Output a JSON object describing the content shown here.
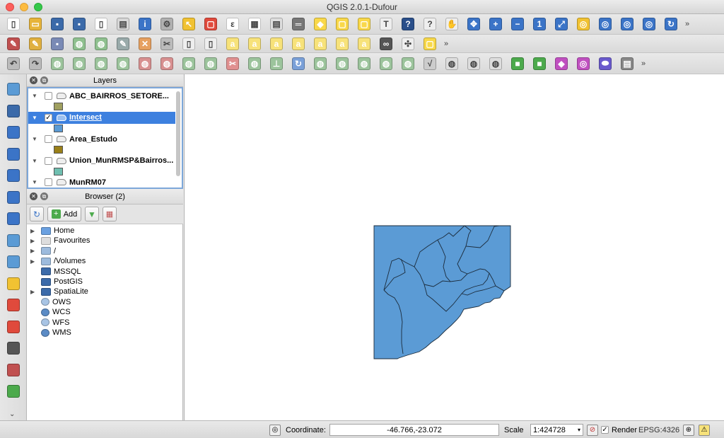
{
  "window": {
    "title": "QGIS 2.0.1-Dufour"
  },
  "toolbar_rows": [
    {
      "icons": [
        {
          "name": "new-project-icon",
          "color": "#ffffff",
          "glyph": "▯"
        },
        {
          "name": "open-project-icon",
          "color": "#e7b43a",
          "glyph": "▭"
        },
        {
          "name": "save-project-icon",
          "color": "#3b6aa9",
          "glyph": "▪"
        },
        {
          "name": "save-as-icon",
          "color": "#3b6aa9",
          "glyph": "▪"
        },
        {
          "name": "new-print-composer-icon",
          "color": "#ffffff",
          "glyph": "▯"
        },
        {
          "name": "composer-manager-icon",
          "color": "#d7d7d7",
          "glyph": "▤"
        },
        {
          "name": "identify-features-icon",
          "color": "#3b74c7",
          "glyph": "i"
        },
        {
          "name": "settings-gear-icon",
          "color": "#b0b0b0",
          "glyph": "⚙"
        },
        {
          "name": "select-features-icon",
          "color": "#f1c232",
          "glyph": "↖"
        },
        {
          "name": "deselect-icon",
          "color": "#e04a3c",
          "glyph": "▢"
        },
        {
          "name": "field-calculator-icon",
          "color": "#ffffff",
          "glyph": "ε"
        },
        {
          "name": "attribute-table-icon",
          "color": "#ffffff",
          "glyph": "▦"
        },
        {
          "name": "statistics-icon",
          "color": "#dddddd",
          "glyph": "▤"
        },
        {
          "name": "measure-line-icon",
          "color": "#777777",
          "glyph": "═"
        },
        {
          "name": "map-tips-icon",
          "color": "#f9d84a",
          "glyph": "◆"
        },
        {
          "name": "new-bookmark-icon",
          "color": "#f9d84a",
          "glyph": "▢"
        },
        {
          "name": "show-bookmarks-icon",
          "color": "#f9d84a",
          "glyph": "▢"
        },
        {
          "name": "text-annotation-icon",
          "color": "#eeeeee",
          "glyph": "T"
        },
        {
          "name": "help-icon",
          "color": "#2a4f8a",
          "glyph": "?"
        },
        {
          "name": "whats-this-icon",
          "color": "#eeeeee",
          "glyph": "?"
        },
        {
          "name": "pan-map-icon",
          "color": "#eeeeee",
          "glyph": "✋"
        },
        {
          "name": "pan-to-selection-icon",
          "color": "#3b74c7",
          "glyph": "✥"
        },
        {
          "name": "zoom-in-icon",
          "color": "#3b74c7",
          "glyph": "+"
        },
        {
          "name": "zoom-out-icon",
          "color": "#3b74c7",
          "glyph": "−"
        },
        {
          "name": "zoom-actual-size-icon",
          "color": "#3b74c7",
          "glyph": "1"
        },
        {
          "name": "zoom-full-icon",
          "color": "#3b74c7",
          "glyph": "⤢"
        },
        {
          "name": "zoom-to-selection-icon",
          "color": "#f1c232",
          "glyph": "◎"
        },
        {
          "name": "zoom-to-layer-icon",
          "color": "#3b74c7",
          "glyph": "◎"
        },
        {
          "name": "zoom-last-icon",
          "color": "#3b74c7",
          "glyph": "◎"
        },
        {
          "name": "zoom-next-icon",
          "color": "#3b74c7",
          "glyph": "◎"
        },
        {
          "name": "refresh-icon",
          "color": "#3b74c7",
          "glyph": "↻"
        }
      ]
    },
    {
      "icons": [
        {
          "name": "current-edits-icon",
          "color": "#c05050",
          "glyph": "✎"
        },
        {
          "name": "toggle-editing-icon",
          "color": "#e0b040",
          "glyph": "✎"
        },
        {
          "name": "save-edits-icon",
          "color": "#7a8ab5",
          "glyph": "▪"
        },
        {
          "name": "add-feature-icon",
          "color": "#8fc08f",
          "glyph": "◍"
        },
        {
          "name": "move-feature-icon",
          "color": "#8fc08f",
          "glyph": "◍"
        },
        {
          "name": "node-tool-icon",
          "color": "#9aa",
          "glyph": "✎"
        },
        {
          "name": "delete-selected-icon",
          "color": "#e6a060",
          "glyph": "✕"
        },
        {
          "name": "cut-features-icon",
          "color": "#bbbbbb",
          "glyph": "✂"
        },
        {
          "name": "copy-features-icon",
          "color": "#eeeeee",
          "glyph": "▯"
        },
        {
          "name": "paste-features-icon",
          "color": "#eeeeee",
          "glyph": "▯"
        },
        {
          "name": "label-icon",
          "color": "#f7e27a",
          "glyph": "a"
        },
        {
          "name": "label-highlight-icon",
          "color": "#f7e27a",
          "glyph": "a"
        },
        {
          "name": "pin-labels-icon",
          "color": "#f7e27a",
          "glyph": "a"
        },
        {
          "name": "show-hide-labels-icon",
          "color": "#f7e27a",
          "glyph": "a"
        },
        {
          "name": "move-label-icon",
          "color": "#f7e27a",
          "glyph": "a"
        },
        {
          "name": "rotate-label-icon",
          "color": "#f7e27a",
          "glyph": "a"
        },
        {
          "name": "change-label-icon",
          "color": "#f7e27a",
          "glyph": "a"
        },
        {
          "name": "find-binoculars-icon",
          "color": "#555555",
          "glyph": "∞"
        },
        {
          "name": "geocode-icon",
          "color": "#eeeeee",
          "glyph": "✣"
        },
        {
          "name": "sticky-note-icon",
          "color": "#f7d84a",
          "glyph": "▢"
        }
      ]
    },
    {
      "icons": [
        {
          "name": "undo-icon",
          "color": "#bbbbbb",
          "glyph": "↶"
        },
        {
          "name": "redo-icon",
          "color": "#bbbbbb",
          "glyph": "↷"
        },
        {
          "name": "simplify-feature-icon",
          "color": "#9cc49c",
          "glyph": "◍"
        },
        {
          "name": "add-ring-icon",
          "color": "#9cc49c",
          "glyph": "◍"
        },
        {
          "name": "add-part-icon",
          "color": "#9cc49c",
          "glyph": "◍"
        },
        {
          "name": "fill-ring-icon",
          "color": "#9cc49c",
          "glyph": "◍"
        },
        {
          "name": "delete-ring-icon",
          "color": "#d89090",
          "glyph": "◍"
        },
        {
          "name": "delete-part-icon",
          "color": "#d89090",
          "glyph": "◍"
        },
        {
          "name": "reshape-features-icon",
          "color": "#9cc49c",
          "glyph": "◍"
        },
        {
          "name": "offset-curve-icon",
          "color": "#9cc49c",
          "glyph": "◍"
        },
        {
          "name": "split-features-icon",
          "color": "#e09090",
          "glyph": "✂"
        },
        {
          "name": "split-parts-icon",
          "color": "#9cc49c",
          "glyph": "◍"
        },
        {
          "name": "merge-selected-icon",
          "color": "#9cc49c",
          "glyph": "⊥"
        },
        {
          "name": "rotate-point-icon",
          "color": "#7aa0d8",
          "glyph": "↻"
        },
        {
          "name": "digitize-icon",
          "color": "#9cc49c",
          "glyph": "◍"
        },
        {
          "name": "advanced-digitize-icon",
          "color": "#9cc49c",
          "glyph": "◍"
        },
        {
          "name": "snapping-icon",
          "color": "#9cc49c",
          "glyph": "◍"
        },
        {
          "name": "trace-icon",
          "color": "#9cc49c",
          "glyph": "◍"
        },
        {
          "name": "vertex-icon",
          "color": "#9cc49c",
          "glyph": "◍"
        },
        {
          "name": "line-tool-icon",
          "color": "#cccccc",
          "glyph": "√"
        },
        {
          "name": "polygon-tool-icon",
          "color": "#dddddd",
          "glyph": "◍"
        },
        {
          "name": "shape-tool-icon",
          "color": "#dddddd",
          "glyph": "◍"
        },
        {
          "name": "outline-tool-icon",
          "color": "#dddddd",
          "glyph": "◍"
        },
        {
          "name": "rectangle-select-icon",
          "color": "#4caa4c",
          "glyph": "■"
        },
        {
          "name": "square-center-icon",
          "color": "#4caa4c",
          "glyph": "■"
        },
        {
          "name": "square-handles-icon",
          "color": "#c050c0",
          "glyph": "◆"
        },
        {
          "name": "circle-point-icon",
          "color": "#c050c0",
          "glyph": "◎"
        },
        {
          "name": "ellipse-icon",
          "color": "#6a5acd",
          "glyph": "⬬"
        },
        {
          "name": "plugin-toolbox-icon",
          "color": "#888888",
          "glyph": "▤"
        }
      ]
    }
  ],
  "left_tools": [
    {
      "name": "add-vector-layer-icon",
      "color": "#5b9bd5"
    },
    {
      "name": "add-raster-layer-icon",
      "color": "#3b6aa9"
    },
    {
      "name": "add-postgis-layer-icon",
      "color": "#3b74c7"
    },
    {
      "name": "add-spatialite-layer-icon",
      "color": "#3b74c7"
    },
    {
      "name": "add-mssql-layer-icon",
      "color": "#3b74c7"
    },
    {
      "name": "add-wms-layer-icon",
      "color": "#3b74c7"
    },
    {
      "name": "add-wcs-layer-icon",
      "color": "#3b74c7"
    },
    {
      "name": "add-wfs-layer-icon",
      "color": "#5b9bd5"
    },
    {
      "name": "add-delimited-text-icon",
      "color": "#5b9bd5"
    },
    {
      "name": "new-vector-layer-icon",
      "color": "#f1c232"
    },
    {
      "name": "remove-layer-icon",
      "color": "#e04a3c"
    },
    {
      "name": "georeferencer-icon",
      "color": "#e04a3c"
    },
    {
      "name": "gps-tools-icon",
      "color": "#555555"
    },
    {
      "name": "vector-fields-icon",
      "color": "#c05050"
    },
    {
      "name": "table-manager-icon",
      "color": "#4caa4c"
    }
  ],
  "layers_panel": {
    "title": "Layers",
    "items": [
      {
        "name": "ABC_BAIRROS_SETORE...",
        "checked": false,
        "selected": false,
        "swatch": "#a0a060"
      },
      {
        "name": "Intersect",
        "checked": true,
        "selected": true,
        "swatch": "#5b9bd5"
      },
      {
        "name": "Area_Estudo",
        "checked": false,
        "selected": false,
        "swatch": "#9a8018"
      },
      {
        "name": "Union_MunRMSP&Bairros...",
        "checked": false,
        "selected": false,
        "swatch": "#6fbfb0"
      },
      {
        "name": "MunRM07",
        "checked": false,
        "selected": false,
        "swatch": null
      }
    ]
  },
  "browser_panel": {
    "title": "Browser (2)",
    "add_label": "Add",
    "items": [
      {
        "label": "Home",
        "expandable": true,
        "icon": "folder-icon",
        "color": "#6aa0e0"
      },
      {
        "label": "Favourites",
        "expandable": true,
        "icon": "star-icon",
        "color": "#dddddd"
      },
      {
        "label": "/",
        "expandable": true,
        "icon": "folder-icon",
        "color": "#9dbbdd"
      },
      {
        "label": "/Volumes",
        "expandable": true,
        "icon": "folder-icon",
        "color": "#9dbbdd"
      },
      {
        "label": "MSSQL",
        "expandable": false,
        "icon": "mssql-icon",
        "color": "#3b6aa9"
      },
      {
        "label": "PostGIS",
        "expandable": false,
        "icon": "postgis-icon",
        "color": "#3b6aa9"
      },
      {
        "label": "SpatiaLite",
        "expandable": true,
        "icon": "spatialite-icon",
        "color": "#3b6aa9"
      },
      {
        "label": "OWS",
        "expandable": false,
        "icon": "globe-icon",
        "color": "#a8c4e4"
      },
      {
        "label": "WCS",
        "expandable": false,
        "icon": "globe-icon",
        "color": "#5b8bc5"
      },
      {
        "label": "WFS",
        "expandable": false,
        "icon": "globe-icon",
        "color": "#a8c4e4"
      },
      {
        "label": "WMS",
        "expandable": false,
        "icon": "globe-icon",
        "color": "#5b8bc5"
      }
    ]
  },
  "map": {
    "polygon_fill": "#5b9bd5",
    "polygon_stroke": "#1b2b3b"
  },
  "statusbar": {
    "coordinate_label": "Coordinate:",
    "coordinate_value": "-46.766,-23.072",
    "scale_label": "Scale",
    "scale_value": "1:424728",
    "render_label": "Render",
    "render_checked": true,
    "crs": "EPSG:4326"
  }
}
